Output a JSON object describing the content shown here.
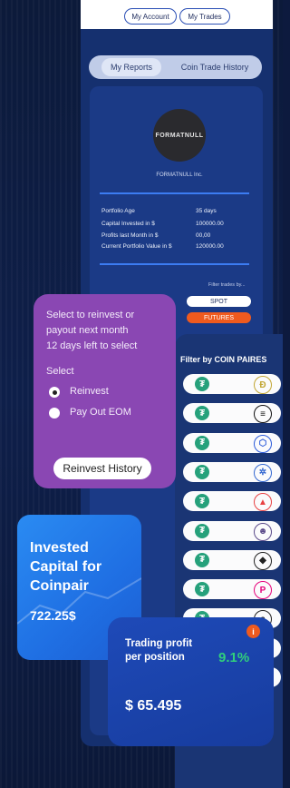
{
  "header": {
    "my_account": "My Account",
    "my_trades": "My Trades"
  },
  "tabs": [
    {
      "label": "My Reports",
      "active": true
    },
    {
      "label": "Coin Trade History",
      "active": false
    }
  ],
  "profile": {
    "logo_text": "FORMATNULL",
    "company": "FORMATNULL Inc."
  },
  "portfolio": [
    {
      "label": "Portfolio Age",
      "value": "35 days"
    },
    {
      "label": "Capital Invested in $",
      "value": "100000.00"
    },
    {
      "label": "Profits last Month in $",
      "value": "00,00"
    },
    {
      "label": "Current Portfolio Value in $",
      "value": "120000.00"
    }
  ],
  "filter": {
    "label": "Filter trades by...",
    "spot": "SPOT",
    "futures": "FUTURES"
  },
  "reinvest": {
    "line1": "Select to reinvest or",
    "line2": "payout next month",
    "line3": "12  days left to select",
    "select_label": "Select",
    "option_reinvest": "Reinvest",
    "option_payout": "Pay Out EOM",
    "history_button": "Reinvest History"
  },
  "coin_pairs": {
    "title": "Filter by COIN PAIRES",
    "base_icon": "tether-icon",
    "items": [
      {
        "icon": "dogecoin-icon",
        "color": "#c2a633",
        "glyph": "Ð"
      },
      {
        "icon": "solana-icon",
        "color": "#111111",
        "glyph": "≡"
      },
      {
        "icon": "chainlink-icon",
        "color": "#2a5ada",
        "glyph": "⬡"
      },
      {
        "icon": "cardano-icon",
        "color": "#3468d1",
        "glyph": "✲"
      },
      {
        "icon": "avalanche-icon",
        "color": "#e84142",
        "glyph": "▲"
      },
      {
        "icon": "floki-icon",
        "color": "#5a4a8a",
        "glyph": "☻"
      },
      {
        "icon": "ethereum-icon",
        "color": "#222222",
        "glyph": "◆"
      },
      {
        "icon": "polkadot-icon",
        "color": "#e6007a",
        "glyph": "P"
      },
      {
        "icon": "arweave-icon",
        "color": "#222222",
        "glyph": "a"
      },
      {
        "icon": "coin-icon",
        "color": "#ef5a1e",
        "glyph": "●"
      },
      {
        "icon": "ripple-icon",
        "color": "#222222",
        "glyph": "✕"
      }
    ]
  },
  "invested": {
    "title": "Invested Capital for Coinpair",
    "value": "722.25$"
  },
  "trading": {
    "title": "Trading profit per position",
    "percent": "9.1%",
    "amount": "$ 65.495",
    "info_glyph": "i"
  }
}
